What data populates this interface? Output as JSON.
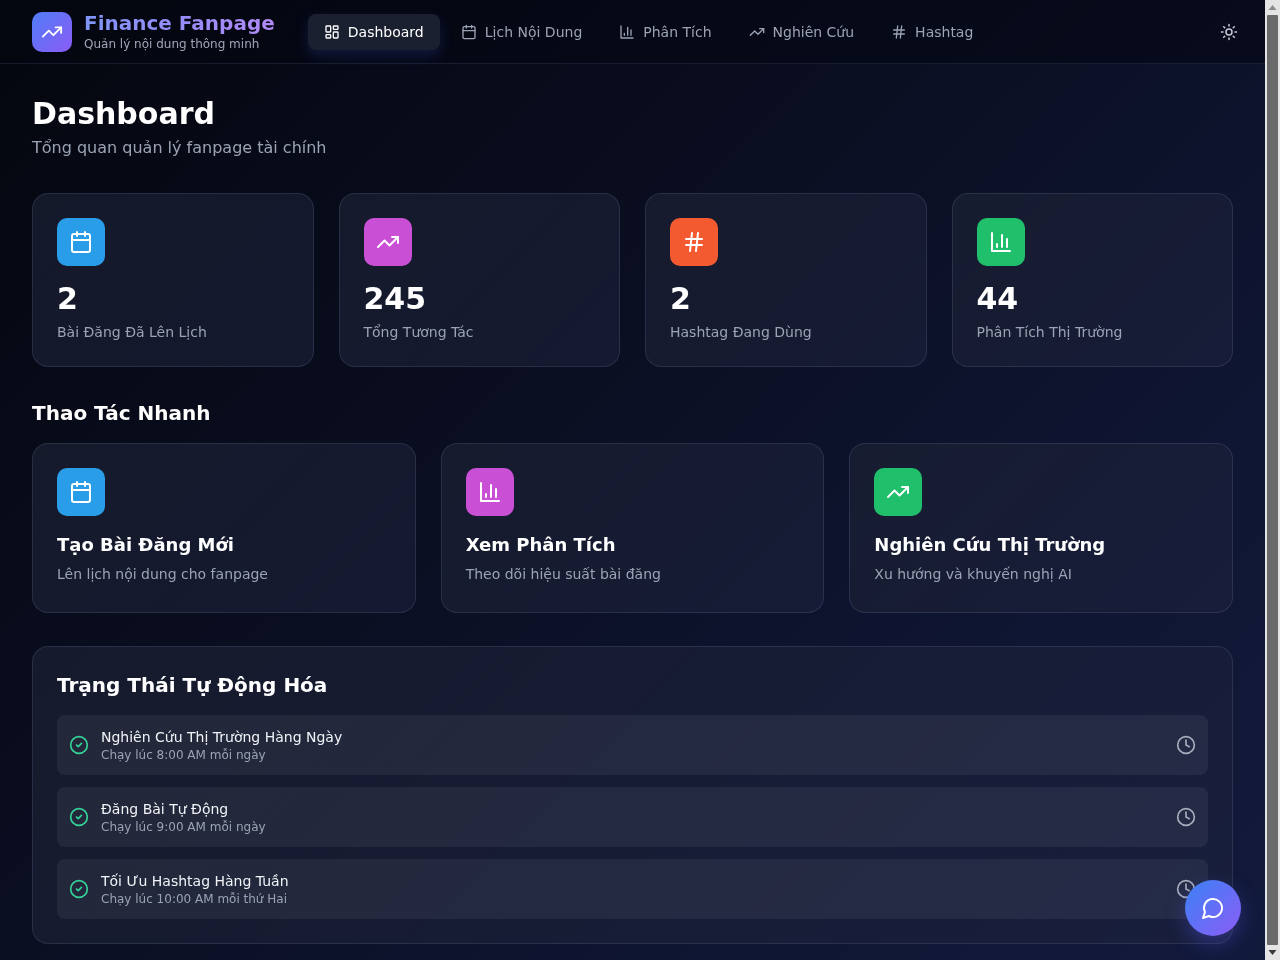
{
  "header": {
    "brand": {
      "title": "Finance Fanpage",
      "subtitle": "Quản lý nội dung thông minh"
    },
    "nav": [
      {
        "label": "Dashboard",
        "selected": true
      },
      {
        "label": "Lịch Nội Dung",
        "selected": false
      },
      {
        "label": "Phân Tích",
        "selected": false
      },
      {
        "label": "Nghiên Cứu",
        "selected": false
      },
      {
        "label": "Hashtag",
        "selected": false
      }
    ]
  },
  "page": {
    "title": "Dashboard",
    "subtitle": "Tổng quan quản lý fanpage tài chính"
  },
  "stats": [
    {
      "value": "2",
      "label": "Bài Đăng Đã Lên Lịch",
      "color": "#2a9de8"
    },
    {
      "value": "245",
      "label": "Tổng Tương Tác",
      "color": "#c94fd4"
    },
    {
      "value": "2",
      "label": "Hashtag Đang Dùng",
      "color": "#f35a30"
    },
    {
      "value": "44",
      "label": "Phân Tích Thị Trường",
      "color": "#1fbf6c"
    }
  ],
  "quick_actions": {
    "title": "Thao Tác Nhanh",
    "items": [
      {
        "title": "Tạo Bài Đăng Mới",
        "description": "Lên lịch nội dung cho fanpage",
        "color": "#2a9de8"
      },
      {
        "title": "Xem Phân Tích",
        "description": "Theo dõi hiệu suất bài đăng",
        "color": "#c94fd4"
      },
      {
        "title": "Nghiên Cứu Thị Trường",
        "description": "Xu hướng và khuyến nghị AI",
        "color": "#1fbf6c"
      }
    ]
  },
  "automation": {
    "title": "Trạng Thái Tự Động Hóa",
    "tasks": [
      {
        "name": "Nghiên Cứu Thị Trường Hàng Ngày",
        "schedule": "Chạy lúc 8:00 AM mỗi ngày",
        "active": true
      },
      {
        "name": "Đăng Bài Tự Động",
        "schedule": "Chạy lúc 9:00 AM mỗi ngày",
        "active": true
      },
      {
        "name": "Tối Ưu Hashtag Hàng Tuần",
        "schedule": "Chạy lúc 10:00 AM mỗi thứ Hai",
        "active": true
      }
    ]
  }
}
